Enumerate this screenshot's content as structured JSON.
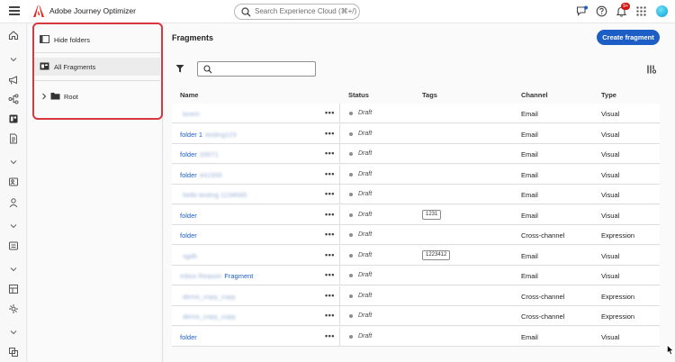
{
  "header": {
    "app_title": "Adobe Journey Optimizer",
    "search_placeholder": "Search Experience Cloud (⌘+/)",
    "notification_count": "9+"
  },
  "folders": {
    "hide_label": "Hide folders",
    "all_label": "All Fragments",
    "root_label": "Root"
  },
  "main": {
    "title": "Fragments",
    "create_label": "Create fragment"
  },
  "table": {
    "columns": [
      "Name",
      "Status",
      "Tags",
      "Channel",
      "Type"
    ],
    "rows": [
      {
        "name_link": "",
        "name_blur": "lorem",
        "status": "Draft",
        "tag": "",
        "channel": "Email",
        "type": "Visual"
      },
      {
        "name_link": "folder 1",
        "name_blur": "testing123",
        "status": "Draft",
        "tag": "",
        "channel": "Email",
        "type": "Visual"
      },
      {
        "name_link": "folder",
        "name_blur": "33571",
        "status": "Draft",
        "tag": "",
        "channel": "Email",
        "type": "Visual"
      },
      {
        "name_link": "folder",
        "name_blur": "441555",
        "status": "Draft",
        "tag": "",
        "channel": "Email",
        "type": "Visual"
      },
      {
        "name_link": "",
        "name_blur": "hello testing 1234565",
        "status": "Draft",
        "tag": "",
        "channel": "Email",
        "type": "Visual"
      },
      {
        "name_link": "folder",
        "name_blur": "",
        "status": "Draft",
        "tag": "1231",
        "channel": "Email",
        "type": "Visual"
      },
      {
        "name_link": "folder",
        "name_blur": "",
        "status": "Draft",
        "tag": "",
        "channel": "Cross-channel",
        "type": "Expression"
      },
      {
        "name_link": "",
        "name_blur": "sgdh",
        "status": "Draft",
        "tag": "1223412",
        "channel": "Email",
        "type": "Visual"
      },
      {
        "name_link": "Fragment",
        "name_blur": "Inbox Reason",
        "status": "Draft",
        "tag": "",
        "channel": "Email",
        "type": "Visual"
      },
      {
        "name_link": "",
        "name_blur": "demo_copy_copy",
        "status": "Draft",
        "tag": "",
        "channel": "Cross-channel",
        "type": "Expression"
      },
      {
        "name_link": "",
        "name_blur": "demo_copy_copy",
        "status": "Draft",
        "tag": "",
        "channel": "Cross-channel",
        "type": "Expression"
      },
      {
        "name_link": "folder",
        "name_blur": "",
        "status": "Draft",
        "tag": "",
        "channel": "Email",
        "type": "Visual"
      }
    ]
  }
}
